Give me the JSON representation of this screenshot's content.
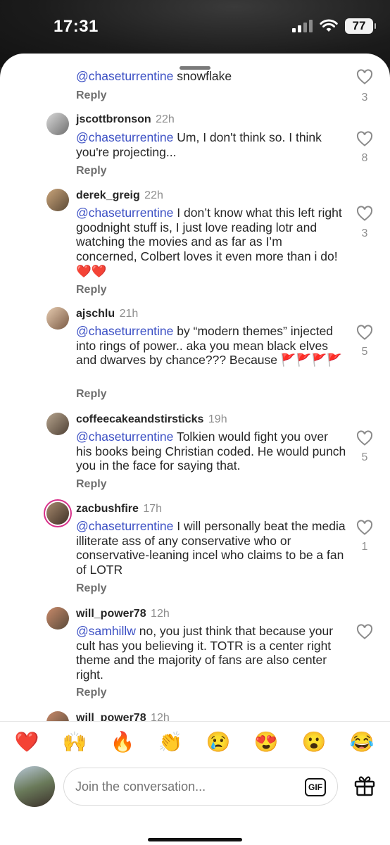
{
  "status": {
    "time": "17:31",
    "battery": "77"
  },
  "comments": [
    {
      "username": "",
      "time": "",
      "mention": "@chaseturrentine",
      "text": " snowflake",
      "reply": "Reply",
      "likes": "3"
    },
    {
      "username": "jscottbronson",
      "time": "22h",
      "mention": "@chaseturrentine",
      "text": " Um, I don't think so. I think you're projecting...",
      "reply": "Reply",
      "likes": "8"
    },
    {
      "username": "derek_greig",
      "time": "22h",
      "mention": "@chaseturrentine",
      "text": " I don’t know what this left right goodnight stuff is, I just love reading lotr and watching the movies and as far as I’m concerned, Colbert loves it even more than i do! ❤️❤️",
      "reply": "Reply",
      "likes": "3"
    },
    {
      "username": "ajschlu",
      "time": "21h",
      "mention": "@chaseturrentine",
      "text": " by “modern themes” injected into rings of power.. aka you mean black elves and dwarves by chance??? Because 🚩🚩🚩🚩",
      "reply": "Reply",
      "likes": "5"
    },
    {
      "username": "coffeecakeandstirsticks",
      "time": "19h",
      "mention": "@chaseturrentine",
      "text": " Tolkien would fight you over his books being Christian coded. He would punch you in the face for saying that.",
      "reply": "Reply",
      "likes": "5"
    },
    {
      "username": "zacbushfire",
      "time": "17h",
      "mention": "@chaseturrentine",
      "text": " I will personally beat the media illiterate ass of any conservative who or conservative-leaning incel who claims to be a fan of LOTR",
      "reply": "Reply",
      "likes": "1"
    },
    {
      "username": "will_power78",
      "time": "12h",
      "mention": "@samhillw",
      "text": " no, you just think that because your cult has you believing it. TOTR is a center right theme and the majority of fans are also center right.",
      "reply": "Reply",
      "likes": ""
    },
    {
      "username": "will_power78",
      "time": "12h",
      "mention": "",
      "text": "",
      "reply": "",
      "likes": ""
    }
  ],
  "emojis": [
    "❤️",
    "🙌",
    "🔥",
    "👏",
    "😢",
    "😍",
    "😮",
    "😂"
  ],
  "input": {
    "placeholder": "Join the conversation...",
    "gif_label": "GIF"
  },
  "icons": {
    "heart": "heart-icon",
    "gift": "gift-icon",
    "wifi": "wifi-icon",
    "signal": "signal-icon"
  }
}
